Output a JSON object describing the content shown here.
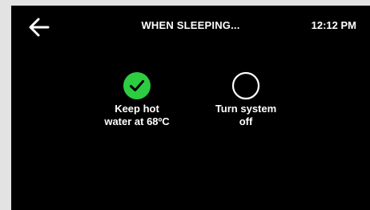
{
  "header": {
    "back_icon": "arrow-left-icon",
    "title": "WHEN SLEEPING...",
    "time": "12:12 PM"
  },
  "options": [
    {
      "label": "Keep hot\nwater at 68ºC",
      "selected": true,
      "icon": "check-circle-icon",
      "color": "#2ecc40"
    },
    {
      "label": "Turn system\noff",
      "selected": false,
      "icon": "empty-circle-icon",
      "color": "#ffffff"
    }
  ],
  "colors": {
    "background": "#000000",
    "frame": "#e3e3e3",
    "text": "#ffffff",
    "selected": "#2ecc40"
  }
}
